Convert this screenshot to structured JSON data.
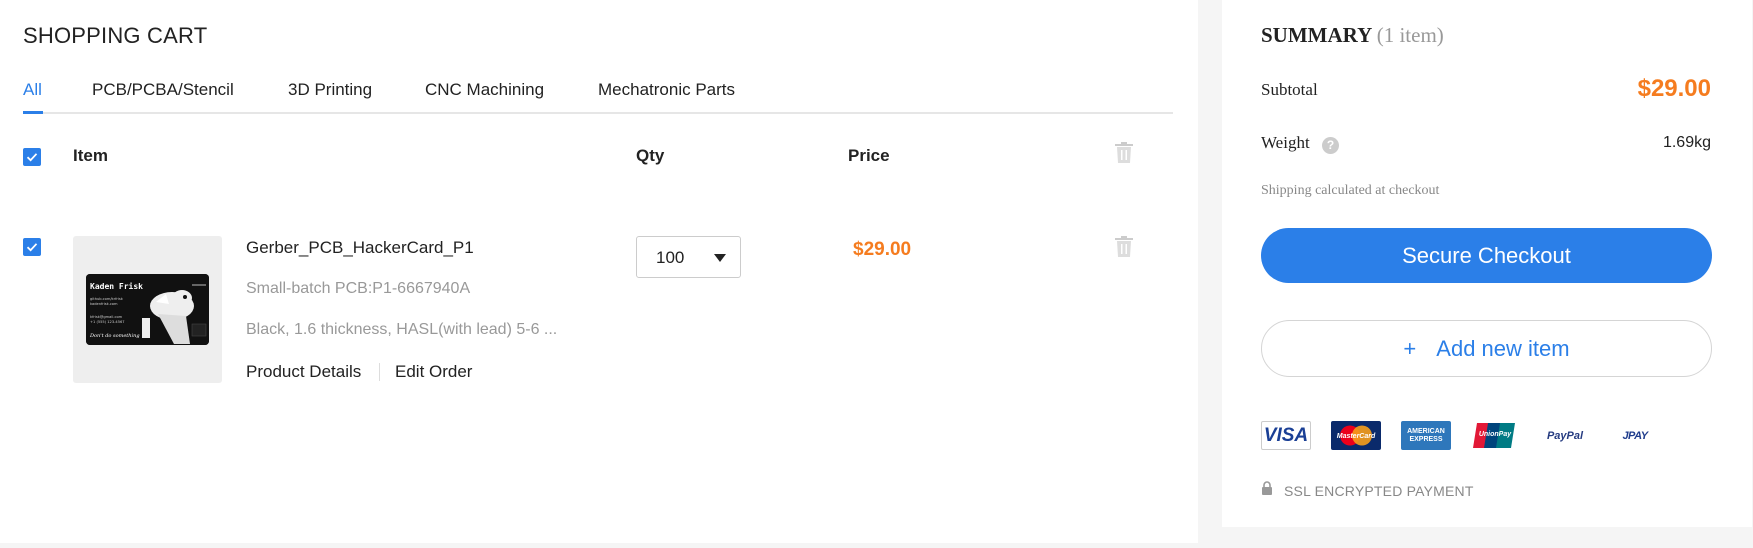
{
  "cart": {
    "title": "SHOPPING CART",
    "tabs": [
      {
        "label": "All",
        "active": true
      },
      {
        "label": "PCB/PCBA/Stencil",
        "active": false
      },
      {
        "label": "3D Printing",
        "active": false
      },
      {
        "label": "CNC Machining",
        "active": false
      },
      {
        "label": "Mechatronic Parts",
        "active": false
      }
    ],
    "columns": {
      "item": "Item",
      "qty": "Qty",
      "price": "Price"
    },
    "items": [
      {
        "name": "Gerber_PCB_HackerCard_P1",
        "subtitle": "Small-batch PCB:P1-6667940A",
        "spec": "Black, 1.6 thickness, HASL(with lead) 5-6 ...",
        "qty": "100",
        "price": "$29.00",
        "details_link": "Product Details",
        "edit_link": "Edit Order",
        "card_text": {
          "name": "Kaden Frisk",
          "line1": "github.com/krfrisk",
          "line2": "kadenfrisk.com",
          "line3": "kfrisk@gmail.com",
          "line4": "+1 (555) 123-4567",
          "tagline": "Don't do something"
        }
      }
    ]
  },
  "summary": {
    "title": "SUMMARY",
    "count": "(1 item)",
    "subtotal_label": "Subtotal",
    "subtotal_value": "$29.00",
    "weight_label": "Weight",
    "weight_value": "1.69kg",
    "help_icon": "?",
    "shipping_note": "Shipping calculated at checkout",
    "checkout_label": "Secure Checkout",
    "add_plus": "+",
    "add_label": "Add new item",
    "payment_logos": [
      "VISA",
      "MasterCard",
      "AMERICAN EXPRESS",
      "UnionPay",
      "PayPal",
      "JPAY"
    ],
    "ssl_text": "SSL ENCRYPTED PAYMENT"
  },
  "colors": {
    "accent": "#2b7fe8",
    "price": "#f57c1f"
  }
}
